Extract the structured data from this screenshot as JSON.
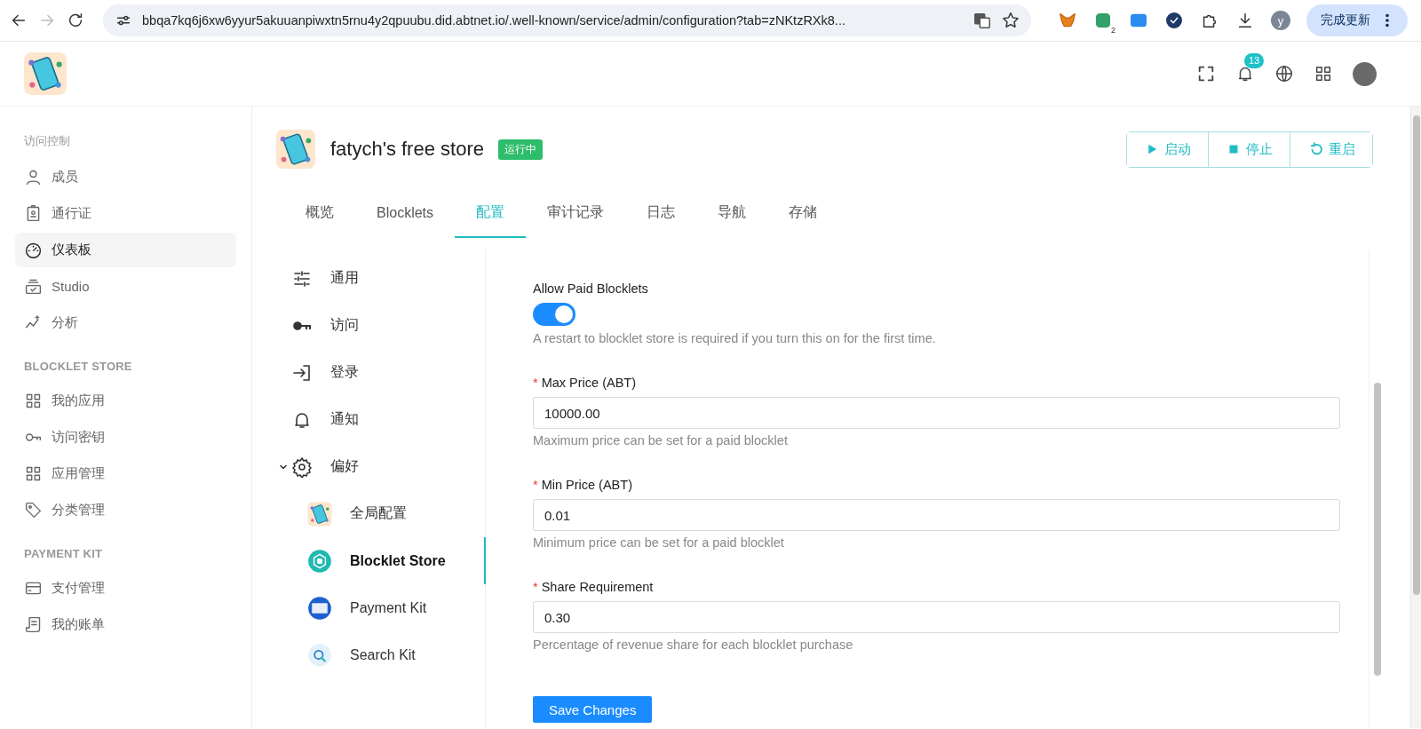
{
  "browser": {
    "url": "bbqa7kq6j6xw6yyur5akuuanpiwxtn5rnu4y2qpuubu.did.abtnet.io/.well-known/service/admin/configuration?tab=zNKtzRXk8...",
    "extension_badge": "2",
    "profile_initial": "y",
    "update_button": "完成更新"
  },
  "header": {
    "notification_count": "13"
  },
  "sidebar": [
    {
      "title": "访问控制",
      "items": [
        {
          "label": "成员",
          "selected": false
        },
        {
          "label": "通行证",
          "selected": false
        },
        {
          "label": "仪表板",
          "selected": true
        },
        {
          "label": "Studio",
          "selected": false
        },
        {
          "label": "分析",
          "selected": false
        }
      ]
    },
    {
      "title": "BLOCKLET STORE",
      "items": [
        {
          "label": "我的应用",
          "selected": false
        },
        {
          "label": "访问密钥",
          "selected": false
        },
        {
          "label": "应用管理",
          "selected": false
        },
        {
          "label": "分类管理",
          "selected": false
        }
      ]
    },
    {
      "title": "PAYMENT KIT",
      "items": [
        {
          "label": "支付管理",
          "selected": false
        },
        {
          "label": "我的账单",
          "selected": false
        }
      ]
    }
  ],
  "app": {
    "name": "fatych's free store",
    "status": "运行中",
    "actions": [
      "启动",
      "停止",
      "重启"
    ]
  },
  "tabs": [
    {
      "label": "概览",
      "selected": false
    },
    {
      "label": "Blocklets",
      "selected": false
    },
    {
      "label": "配置",
      "selected": true
    },
    {
      "label": "审计记录",
      "selected": false
    },
    {
      "label": "日志",
      "selected": false
    },
    {
      "label": "导航",
      "selected": false
    },
    {
      "label": "存储",
      "selected": false
    }
  ],
  "config_menu": [
    {
      "label": "通用",
      "selected": false
    },
    {
      "label": "访问",
      "selected": false
    },
    {
      "label": "登录",
      "selected": false
    },
    {
      "label": "通知",
      "selected": false
    },
    {
      "label": "偏好",
      "selected": false,
      "expanded": true,
      "children": [
        {
          "label": "全局配置",
          "selected": false
        },
        {
          "label": "Blocklet Store",
          "selected": true
        },
        {
          "label": "Payment Kit",
          "selected": false
        },
        {
          "label": "Search Kit",
          "selected": false
        }
      ]
    }
  ],
  "form": {
    "toggle": {
      "label": "Allow Paid Blocklets",
      "on": true,
      "help": "A restart to blocklet store is required if you turn this on for the first time."
    },
    "fields": [
      {
        "label": "Max Price (ABT)",
        "required_mark": "*",
        "value": "10000.00",
        "help": "Maximum price can be set for a paid blocklet"
      },
      {
        "label": "Min Price (ABT)",
        "required_mark": "*",
        "value": "0.01",
        "help": "Minimum price can be set for a paid blocklet"
      },
      {
        "label": "Share Requirement",
        "required_mark": "*",
        "value": "0.30",
        "help": "Percentage of revenue share for each blocklet purchase"
      }
    ],
    "save_button": "Save Changes"
  }
}
